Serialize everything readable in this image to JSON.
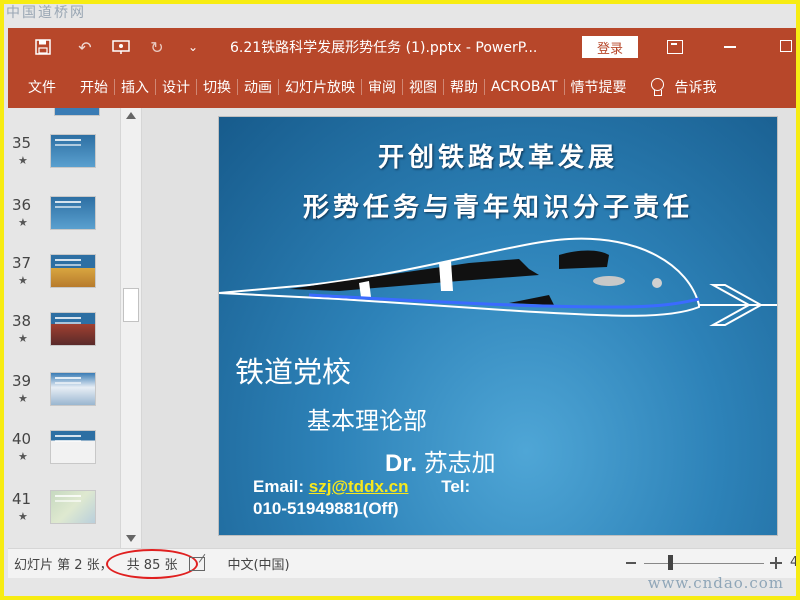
{
  "watermark": {
    "top": "中国道桥网",
    "bottom": "www.cndao.com"
  },
  "titlebar": {
    "doc_title": "6.21铁路科学发展形势任务 (1).pptx  -  PowerP...",
    "login_label": "登录",
    "undo_glyph": "↶",
    "redo_glyph": "↻",
    "customize_glyph": "⌄"
  },
  "ribbon": {
    "tabs": [
      "文件",
      "开始",
      "插入",
      "设计",
      "切换",
      "动画",
      "幻灯片放映",
      "审阅",
      "视图",
      "帮助",
      "ACROBAT",
      "情节提要"
    ],
    "tell_me": "告诉我"
  },
  "thumbnails": [
    {
      "num": "35",
      "star": "★"
    },
    {
      "num": "36",
      "star": "★"
    },
    {
      "num": "37",
      "star": "★"
    },
    {
      "num": "38",
      "star": "★"
    },
    {
      "num": "39",
      "star": "★"
    },
    {
      "num": "40",
      "star": "★"
    },
    {
      "num": "41",
      "star": "★"
    }
  ],
  "slide": {
    "title_line1": "开创铁路改革发展",
    "title_line2": "形势任务与青年知识分子责任",
    "school": "铁道党校",
    "department": "基本理论部",
    "author_prefix": "Dr.",
    "author_name": "苏志加",
    "email_label": "Email:",
    "email": "szj@tddx.cn",
    "tel_label": "Tel:",
    "phone": "010-51949881(Off)"
  },
  "statusbar": {
    "slide_position": "幻灯片 第 2 张，",
    "total": "共 85 张",
    "language": "中文(中国)",
    "zoom_text": "4"
  },
  "colors": {
    "accent": "#b7472a",
    "highlight_border": "#f7ec12",
    "annotation": "#e02020",
    "email": "#f7e81d"
  },
  "icons": [
    "save-icon",
    "undo-icon",
    "present-icon",
    "redo-icon",
    "customize-icon",
    "restore-icon",
    "minimize-icon",
    "maximize-icon",
    "lightbulb-icon",
    "notes-icon"
  ]
}
